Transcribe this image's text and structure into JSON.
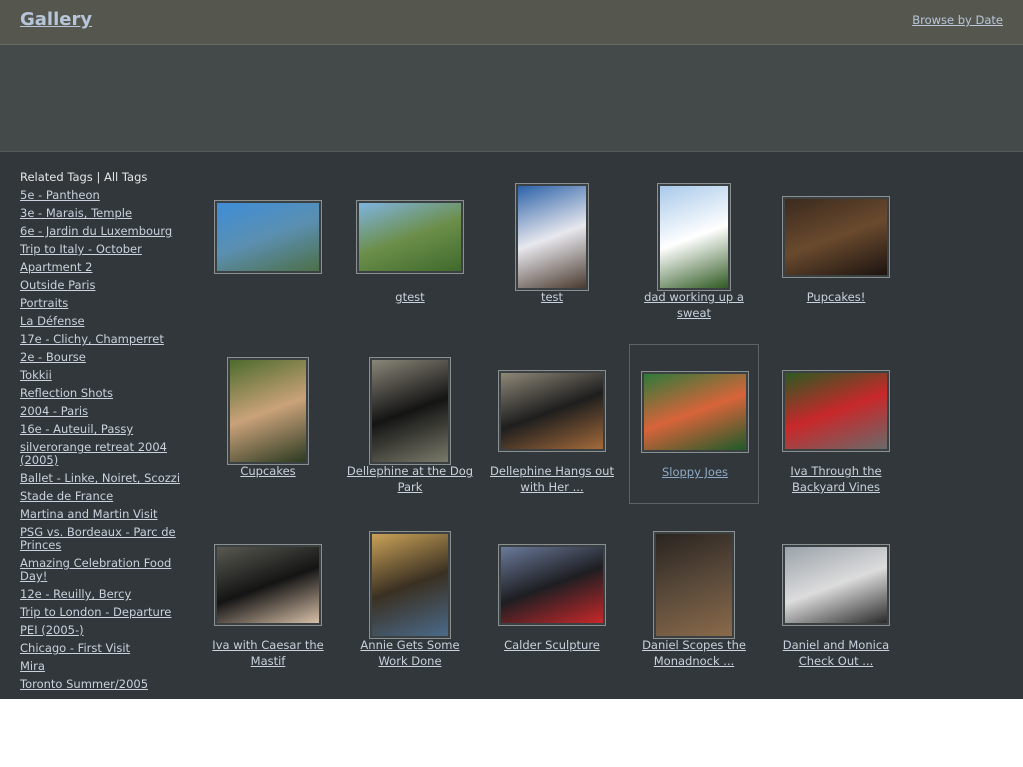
{
  "header": {
    "title": "Gallery",
    "browse_link": "Browse by Date"
  },
  "sidebar": {
    "related_tags": "Related Tags",
    "separator": " | ",
    "all_tags": "All Tags",
    "tags": [
      "5e - Pantheon",
      "3e - Marais, Temple",
      "6e - Jardin du Luxembourg",
      "Trip to Italy - October",
      "Apartment 2",
      "Outside Paris",
      "Portraits",
      "La Défense",
      "17e - Clichy, Champerret",
      "2e - Bourse",
      "Tokkii",
      "Reflection Shots",
      "2004 - Paris",
      "16e - Auteuil, Passy",
      "silverorange retreat 2004 (2005)",
      "Ballet - Linke, Noiret, Scozzi",
      "Stade de France",
      "Martina and Martin Visit",
      "PSG vs. Bordeaux - Parc de Princes",
      "Amazing Celebration Food Day!",
      "12e - Reuilly, Bercy",
      "Trip to London - Departure",
      "PEI (2005-)",
      "Chicago - First Visit",
      "Mira",
      "Toronto Summer/2005"
    ]
  },
  "photos": [
    {
      "caption": "",
      "colors": [
        "#3e8ed8",
        "#5b8fb0",
        "#4d6f48"
      ]
    },
    {
      "caption": "gtest",
      "colors": [
        "#7fb4e0",
        "#6c8e4a",
        "#3f6a2c"
      ]
    },
    {
      "caption": "test",
      "colors": [
        "#2c62a8",
        "#e8e8ee",
        "#4a3a2e"
      ]
    },
    {
      "caption": "dad working up a sweat",
      "colors": [
        "#a8c9ea",
        "#ffffff",
        "#2f5a22"
      ]
    },
    {
      "caption": "Pupcakes!",
      "colors": [
        "#3b2a1e",
        "#6a4a2e",
        "#1c1410"
      ]
    },
    {
      "caption": "Cupcakes",
      "colors": [
        "#4d6b2c",
        "#caa27a",
        "#2c3a22"
      ]
    },
    {
      "caption": "Dellephine at the Dog Park",
      "colors": [
        "#8a8678",
        "#141414",
        "#7a7a6a"
      ]
    },
    {
      "caption": "Dellephine Hangs out with Her ...",
      "colors": [
        "#8f8878",
        "#1e1e1e",
        "#a46a3a"
      ]
    },
    {
      "caption": "Sloppy Joes",
      "colors": [
        "#2f7a3a",
        "#d8643a",
        "#1e5a2a"
      ]
    },
    {
      "caption": "Iva Through the Backyard Vines",
      "colors": [
        "#2c5a22",
        "#c8282a",
        "#6a6a6a"
      ]
    },
    {
      "caption": "Iva with Caesar the Mastif",
      "colors": [
        "#5a5a52",
        "#141414",
        "#d8c0a8"
      ]
    },
    {
      "caption": "Annie Gets Some Work Done",
      "colors": [
        "#caa258",
        "#3a3022",
        "#4a6a8a"
      ]
    },
    {
      "caption": "Calder Sculpture",
      "colors": [
        "#6a7a9a",
        "#1e1e22",
        "#c8282a"
      ]
    },
    {
      "caption": "Daniel Scopes the Monadnock ...",
      "colors": [
        "#2a2420",
        "#5a4a3a",
        "#8a6a4a"
      ]
    },
    {
      "caption": "Daniel and Monica Check Out ...",
      "colors": [
        "#9aa2aa",
        "#dcdcdc",
        "#2a2a2a"
      ]
    }
  ]
}
